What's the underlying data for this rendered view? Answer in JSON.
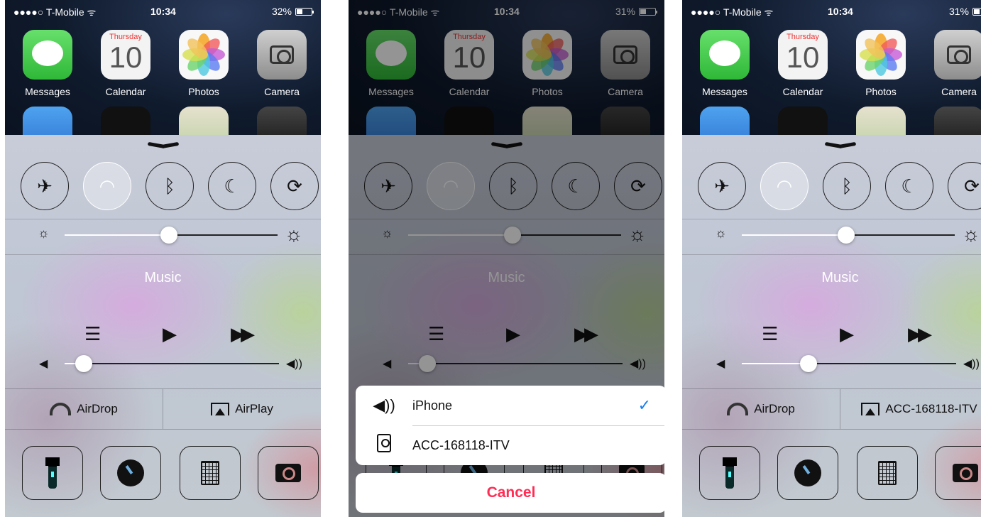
{
  "panels": [
    {
      "status": {
        "carrier": "●●●●○ T-Mobile ᯤ",
        "time": "10:34",
        "battery": "32%"
      },
      "apps": [
        "Messages",
        "Calendar",
        "Photos",
        "Camera"
      ],
      "calendar": {
        "weekday": "Thursday",
        "day": "10"
      },
      "music_title": "Music",
      "airdrop": "AirDrop",
      "airplay": "AirPlay",
      "brightness": 0.49,
      "volume": 0.09,
      "wifi_on": true
    },
    {
      "status": {
        "carrier": "●●●●○ T-Mobile ᯤ",
        "time": "10:34",
        "battery": "31%"
      },
      "apps": [
        "Messages",
        "Calendar",
        "Photos",
        "Camera"
      ],
      "calendar": {
        "weekday": "Thursday",
        "day": "10"
      },
      "music_title": "Music",
      "brightness": 0.49,
      "volume": 0.09,
      "wifi_on": true,
      "airplay_sheet": {
        "devices": [
          {
            "name": "iPhone",
            "icon": "speaker-volume-icon",
            "selected": true
          },
          {
            "name": "ACC-168118-ITV",
            "icon": "apple-tv-speaker-icon",
            "selected": false
          }
        ],
        "cancel": "Cancel",
        "checkmark": "✓"
      }
    },
    {
      "status": {
        "carrier": "●●●●○ T-Mobile ᯤ",
        "time": "10:34",
        "battery": "31%"
      },
      "apps": [
        "Messages",
        "Calendar",
        "Photos",
        "Camera"
      ],
      "calendar": {
        "weekday": "Thursday",
        "day": "10"
      },
      "music_title": "Music",
      "airdrop": "AirDrop",
      "airplay": "ACC-168118-ITV",
      "brightness": 0.49,
      "volume": 0.31,
      "wifi_on": true
    }
  ],
  "icons": {
    "airplane": "✈",
    "wifi": "◠",
    "bluetooth": "ᛒ",
    "moon": "☾",
    "rotation_lock": "⟳",
    "sun_small": "☼",
    "sun_large": "☼",
    "list": "☰",
    "play": "▶",
    "fast_forward": "▶▶",
    "vol_low": "◀",
    "vol_high": "◀))"
  },
  "colors": {
    "checkmark": "#1a7ff2",
    "cancel": "#ff2d55"
  }
}
